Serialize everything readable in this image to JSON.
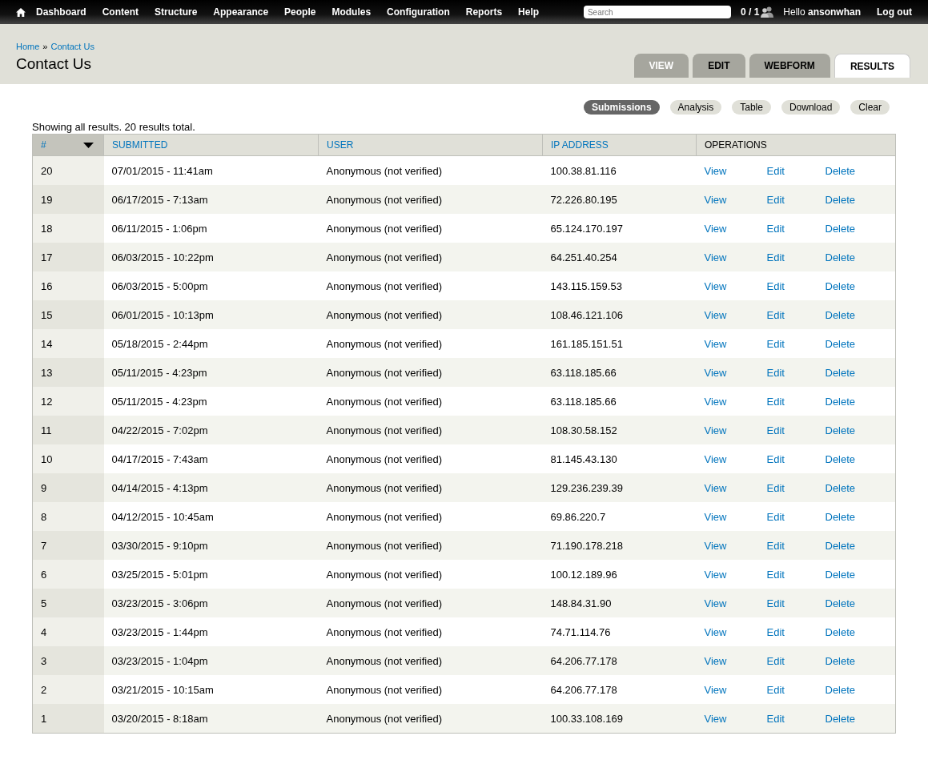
{
  "toolbar": {
    "menu": [
      "Dashboard",
      "Content",
      "Structure",
      "Appearance",
      "People",
      "Modules",
      "Configuration",
      "Reports",
      "Help"
    ],
    "search": {
      "placeholder": "Search"
    },
    "users_online": "0 / 1",
    "greeting": "Hello **ansonwhan**",
    "logout": "Log out"
  },
  "breadcrumb": [
    "Home",
    "Contact Us"
  ],
  "breadcrumb_separator": "»",
  "page_title": "Contact Us",
  "tabs": [
    {
      "label": "VIEW",
      "selected": false
    },
    {
      "label": "EDIT",
      "selected": false
    },
    {
      "label": "WEBFORM",
      "selected": false
    },
    {
      "label": "RESULTS",
      "selected": true
    }
  ],
  "subtabs": [
    {
      "label": "Submissions",
      "selected": true
    },
    {
      "label": "Analysis",
      "selected": false
    },
    {
      "label": "Table",
      "selected": false
    },
    {
      "label": "Download",
      "selected": false
    },
    {
      "label": "Clear",
      "selected": false
    }
  ],
  "summary": "Showing all results. 20 results total.",
  "table": {
    "columns": [
      {
        "label": "#",
        "sortable": true,
        "sorted": true
      },
      {
        "label": "SUBMITTED",
        "sortable": true,
        "sorted": false
      },
      {
        "label": "USER",
        "sortable": true,
        "sorted": false
      },
      {
        "label": "IP ADDRESS",
        "sortable": true,
        "sorted": false
      },
      {
        "label": "OPERATIONS",
        "sortable": false,
        "sorted": false
      }
    ],
    "rows": [
      {
        "number": "20",
        "submitted": "07/01/2015 - 11:41am",
        "user": "Anonymous (not verified)",
        "ip": "100.38.81.116",
        "operations": [
          "View",
          "Edit",
          "Delete"
        ]
      },
      {
        "number": "19",
        "submitted": "06/17/2015 - 7:13am",
        "user": "Anonymous (not verified)",
        "ip": "72.226.80.195",
        "operations": [
          "View",
          "Edit",
          "Delete"
        ]
      },
      {
        "number": "18",
        "submitted": "06/11/2015 - 1:06pm",
        "user": "Anonymous (not verified)",
        "ip": "65.124.170.197",
        "operations": [
          "View",
          "Edit",
          "Delete"
        ]
      },
      {
        "number": "17",
        "submitted": "06/03/2015 - 10:22pm",
        "user": "Anonymous (not verified)",
        "ip": "64.251.40.254",
        "operations": [
          "View",
          "Edit",
          "Delete"
        ]
      },
      {
        "number": "16",
        "submitted": "06/03/2015 - 5:00pm",
        "user": "Anonymous (not verified)",
        "ip": "143.115.159.53",
        "operations": [
          "View",
          "Edit",
          "Delete"
        ]
      },
      {
        "number": "15",
        "submitted": "06/01/2015 - 10:13pm",
        "user": "Anonymous (not verified)",
        "ip": "108.46.121.106",
        "operations": [
          "View",
          "Edit",
          "Delete"
        ]
      },
      {
        "number": "14",
        "submitted": "05/18/2015 - 2:44pm",
        "user": "Anonymous (not verified)",
        "ip": "161.185.151.51",
        "operations": [
          "View",
          "Edit",
          "Delete"
        ]
      },
      {
        "number": "13",
        "submitted": "05/11/2015 - 4:23pm",
        "user": "Anonymous (not verified)",
        "ip": "63.118.185.66",
        "operations": [
          "View",
          "Edit",
          "Delete"
        ]
      },
      {
        "number": "12",
        "submitted": "05/11/2015 - 4:23pm",
        "user": "Anonymous (not verified)",
        "ip": "63.118.185.66",
        "operations": [
          "View",
          "Edit",
          "Delete"
        ]
      },
      {
        "number": "11",
        "submitted": "04/22/2015 - 7:02pm",
        "user": "Anonymous (not verified)",
        "ip": "108.30.58.152",
        "operations": [
          "View",
          "Edit",
          "Delete"
        ]
      },
      {
        "number": "10",
        "submitted": "04/17/2015 - 7:43am",
        "user": "Anonymous (not verified)",
        "ip": "81.145.43.130",
        "operations": [
          "View",
          "Edit",
          "Delete"
        ]
      },
      {
        "number": "9",
        "submitted": "04/14/2015 - 4:13pm",
        "user": "Anonymous (not verified)",
        "ip": "129.236.239.39",
        "operations": [
          "View",
          "Edit",
          "Delete"
        ]
      },
      {
        "number": "8",
        "submitted": "04/12/2015 - 10:45am",
        "user": "Anonymous (not verified)",
        "ip": "69.86.220.7",
        "operations": [
          "View",
          "Edit",
          "Delete"
        ]
      },
      {
        "number": "7",
        "submitted": "03/30/2015 - 9:10pm",
        "user": "Anonymous (not verified)",
        "ip": "71.190.178.218",
        "operations": [
          "View",
          "Edit",
          "Delete"
        ]
      },
      {
        "number": "6",
        "submitted": "03/25/2015 - 5:01pm",
        "user": "Anonymous (not verified)",
        "ip": "100.12.189.96",
        "operations": [
          "View",
          "Edit",
          "Delete"
        ]
      },
      {
        "number": "5",
        "submitted": "03/23/2015 - 3:06pm",
        "user": "Anonymous (not verified)",
        "ip": "148.84.31.90",
        "operations": [
          "View",
          "Edit",
          "Delete"
        ]
      },
      {
        "number": "4",
        "submitted": "03/23/2015 - 1:44pm",
        "user": "Anonymous (not verified)",
        "ip": "74.71.114.76",
        "operations": [
          "View",
          "Edit",
          "Delete"
        ]
      },
      {
        "number": "3",
        "submitted": "03/23/2015 - 1:04pm",
        "user": "Anonymous (not verified)",
        "ip": "64.206.77.178",
        "operations": [
          "View",
          "Edit",
          "Delete"
        ]
      },
      {
        "number": "2",
        "submitted": "03/21/2015 - 10:15am",
        "user": "Anonymous (not verified)",
        "ip": "64.206.77.178",
        "operations": [
          "View",
          "Edit",
          "Delete"
        ]
      },
      {
        "number": "1",
        "submitted": "03/20/2015 - 8:18am",
        "user": "Anonymous (not verified)",
        "ip": "100.33.108.169",
        "operations": [
          "View",
          "Edit",
          "Delete"
        ]
      }
    ]
  }
}
